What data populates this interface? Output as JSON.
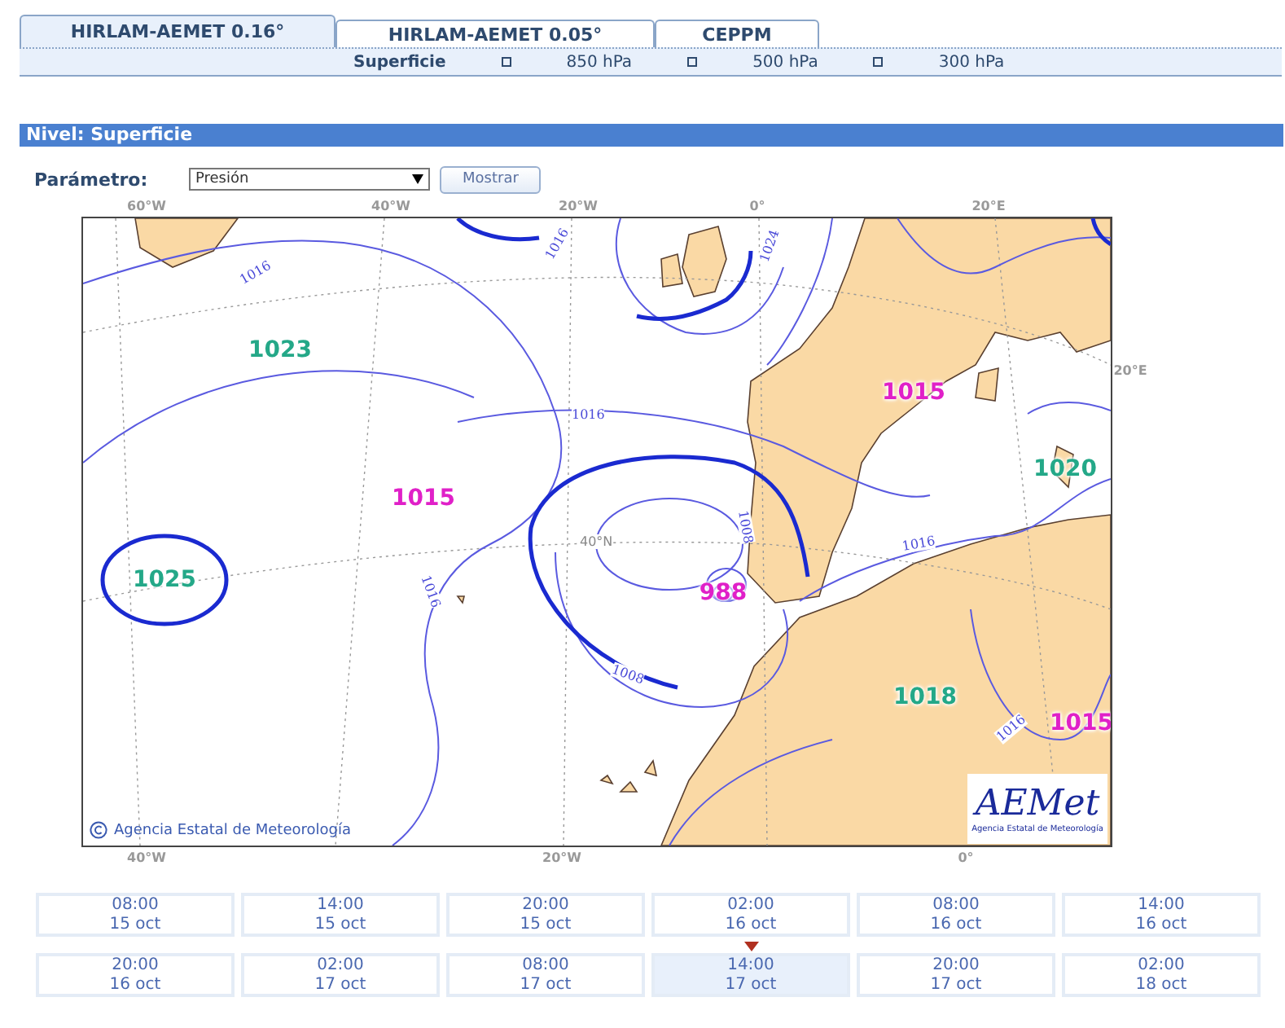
{
  "model_tabs": [
    {
      "label": "HIRLAM-AEMET 0.16°",
      "selected": true
    },
    {
      "label": "HIRLAM-AEMET 0.05°",
      "selected": false
    },
    {
      "label": "CEPPM",
      "selected": false
    }
  ],
  "levels": [
    {
      "label": "Superficie",
      "selected": true
    },
    {
      "label": "850 hPa",
      "selected": false
    },
    {
      "label": "500 hPa",
      "selected": false
    },
    {
      "label": "300 hPa",
      "selected": false
    }
  ],
  "level_header": "Nivel: Superficie",
  "parameter": {
    "label": "Parámetro:",
    "value": "Presión",
    "button": "Mostrar"
  },
  "map": {
    "top_axis": [
      "60°W",
      "40°W",
      "20°W",
      "0°",
      "20°E"
    ],
    "right_axis": [
      "20°E"
    ],
    "bottom_axis": [
      "40°W",
      "20°W",
      "0°"
    ],
    "inner_labels": [
      "40°N"
    ],
    "centers": [
      {
        "value": "1023",
        "kind": "high"
      },
      {
        "value": "1025",
        "kind": "high"
      },
      {
        "value": "1015",
        "kind": "low"
      },
      {
        "value": "988",
        "kind": "low"
      },
      {
        "value": "1015",
        "kind": "low"
      },
      {
        "value": "1020",
        "kind": "high"
      },
      {
        "value": "1018",
        "kind": "high"
      },
      {
        "value": "1015",
        "kind": "low"
      }
    ],
    "isobar_labels": [
      "1016",
      "1016",
      "1016",
      "1016",
      "1008",
      "1008",
      "1016",
      "1016",
      "1024"
    ],
    "credit": "Agencia Estatal de Meteorología",
    "logo": {
      "wordmark": "AEMet",
      "caption": "Agencia Estatal de Meteorología"
    }
  },
  "times": [
    {
      "time": "08:00",
      "date": "15 oct",
      "selected": false
    },
    {
      "time": "14:00",
      "date": "15 oct",
      "selected": false
    },
    {
      "time": "20:00",
      "date": "15 oct",
      "selected": false
    },
    {
      "time": "02:00",
      "date": "16 oct",
      "selected": false
    },
    {
      "time": "08:00",
      "date": "16 oct",
      "selected": false
    },
    {
      "time": "14:00",
      "date": "16 oct",
      "selected": false
    },
    {
      "time": "20:00",
      "date": "16 oct",
      "selected": false
    },
    {
      "time": "02:00",
      "date": "17 oct",
      "selected": false
    },
    {
      "time": "08:00",
      "date": "17 oct",
      "selected": false
    },
    {
      "time": "14:00",
      "date": "17 oct",
      "selected": true
    },
    {
      "time": "20:00",
      "date": "17 oct",
      "selected": false
    },
    {
      "time": "02:00",
      "date": "18 oct",
      "selected": false
    }
  ]
}
